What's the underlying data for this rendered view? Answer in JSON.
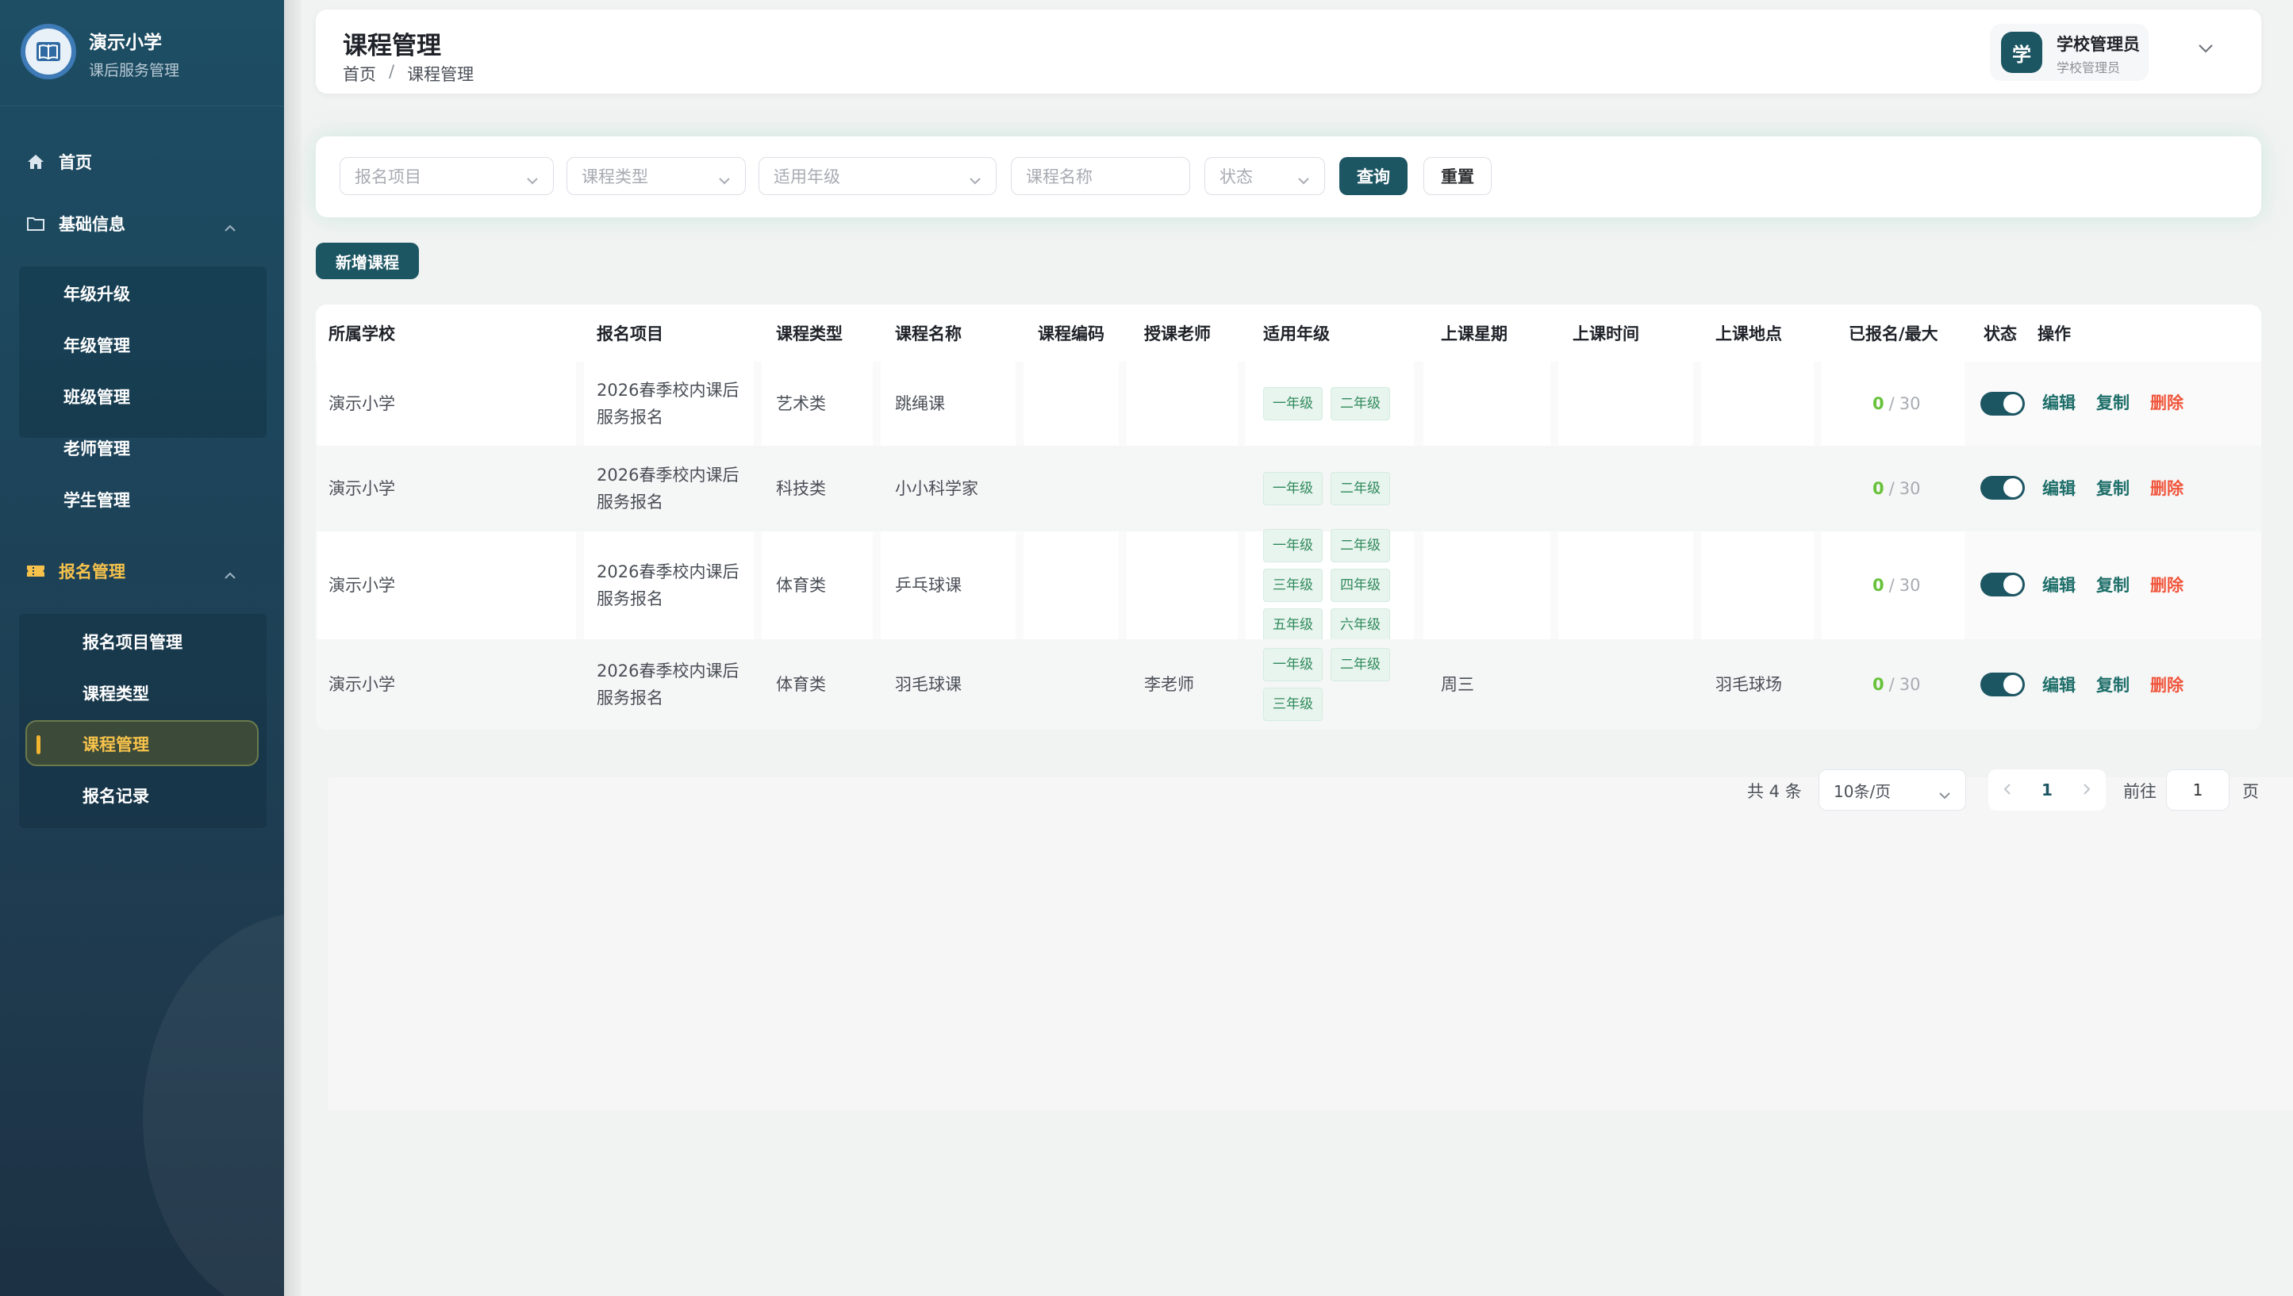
{
  "brand": {
    "title": "演示小学",
    "subtitle": "课后服务管理",
    "logo_icon": "book-badge-icon"
  },
  "sidebar": {
    "home": "首页",
    "basic_info": {
      "label": "基础信息",
      "items": [
        "年级升级",
        "年级管理",
        "班级管理",
        "老师管理",
        "学生管理"
      ]
    },
    "enroll": {
      "label": "报名管理",
      "items": [
        "报名项目管理",
        "课程类型",
        "课程管理",
        "报名记录"
      ],
      "active": "课程管理"
    }
  },
  "header": {
    "title": "课程管理",
    "breadcrumb": [
      "首页",
      "/",
      "课程管理"
    ],
    "user": {
      "avatar_text": "学",
      "name": "学校管理员",
      "role": "学校管理员"
    }
  },
  "filters": {
    "project_placeholder": "报名项目",
    "type_placeholder": "课程类型",
    "grade_placeholder": "适用年级",
    "name_placeholder": "课程名称",
    "status_placeholder": "状态",
    "query_label": "查询",
    "reset_label": "重置"
  },
  "add_button": "新增课程",
  "table": {
    "columns": [
      "所属学校",
      "报名项目",
      "课程类型",
      "课程名称",
      "课程编码",
      "授课老师",
      "适用年级",
      "上课星期",
      "上课时间",
      "上课地点",
      "已报名/最大",
      "状态",
      "操作"
    ],
    "rows": [
      {
        "school": "演示小学",
        "project": "2026春季校内课后服务报名",
        "type": "艺术类",
        "name": "跳绳课",
        "code": "",
        "teacher": "",
        "grades": [
          "一年级",
          "二年级"
        ],
        "weekday": "",
        "time": "",
        "place": "",
        "enrolled": "0",
        "max": "30",
        "enabled": true
      },
      {
        "school": "演示小学",
        "project": "2026春季校内课后服务报名",
        "type": "科技类",
        "name": "小小科学家",
        "code": "",
        "teacher": "",
        "grades": [
          "一年级",
          "二年级"
        ],
        "weekday": "",
        "time": "",
        "place": "",
        "enrolled": "0",
        "max": "30",
        "enabled": true
      },
      {
        "school": "演示小学",
        "project": "2026春季校内课后服务报名",
        "type": "体育类",
        "name": "乒乓球课",
        "code": "",
        "teacher": "",
        "grades": [
          "一年级",
          "二年级",
          "三年级",
          "四年级",
          "五年级",
          "六年级"
        ],
        "weekday": "",
        "time": "",
        "place": "",
        "enrolled": "0",
        "max": "30",
        "enabled": true
      },
      {
        "school": "演示小学",
        "project": "2026春季校内课后服务报名",
        "type": "体育类",
        "name": "羽毛球课",
        "code": "",
        "teacher": "李老师",
        "grades": [
          "一年级",
          "二年级",
          "三年级"
        ],
        "weekday": "周三",
        "time": "",
        "place": "羽毛球场",
        "enrolled": "0",
        "max": "30",
        "enabled": true
      }
    ],
    "actions": {
      "edit": "编辑",
      "copy": "复制",
      "delete": "删除"
    }
  },
  "pagination": {
    "total": "共 4 条",
    "page_size": "10条/页",
    "current": "1",
    "goto_label": "前往",
    "goto_value": "1",
    "unit": "页"
  },
  "colors": {
    "primary": "#1d5663",
    "accent": "#f6c24b",
    "danger": "#f0563c",
    "success": "#67c23a"
  }
}
